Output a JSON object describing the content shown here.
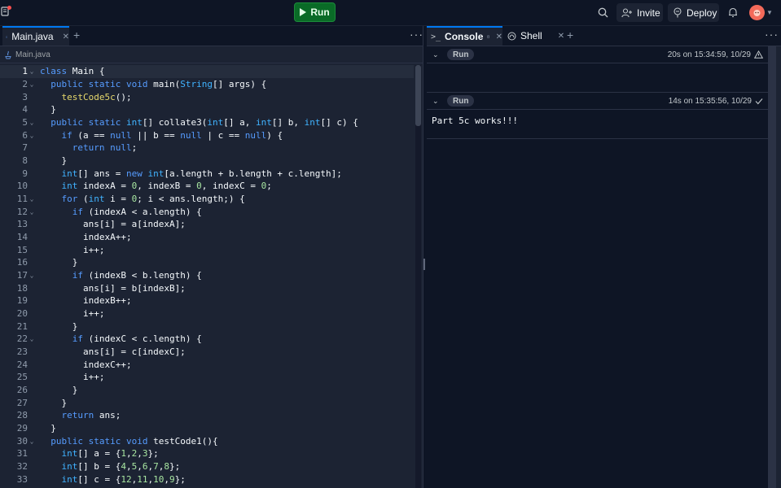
{
  "header": {
    "run_label": "Run",
    "invite_label": "Invite",
    "deploy_label": "Deploy"
  },
  "editor": {
    "tab_label": "Main.java",
    "breadcrumb": "Main.java",
    "lines": [
      {
        "n": "1",
        "fold": true,
        "html": "<span class=\"kw\">class</span> Main {"
      },
      {
        "n": "2",
        "fold": true,
        "html": "  <span class=\"kw\">public static void</span> main(<span class=\"ty\">String</span>[] args) {"
      },
      {
        "n": "3",
        "fold": false,
        "html": "    <span class=\"fn\">testCode5c</span>();"
      },
      {
        "n": "4",
        "fold": false,
        "html": "  }"
      },
      {
        "n": "5",
        "fold": true,
        "html": "  <span class=\"kw\">public static</span> <span class=\"ty\">int</span>[] collate3(<span class=\"ty\">int</span>[] a, <span class=\"ty\">int</span>[] b, <span class=\"ty\">int</span>[] c) {"
      },
      {
        "n": "6",
        "fold": true,
        "html": "    <span class=\"kw\">if</span> (a == <span class=\"kw\">null</span> || b == <span class=\"kw\">null</span> | c == <span class=\"kw\">null</span>) {"
      },
      {
        "n": "7",
        "fold": false,
        "html": "      <span class=\"kw\">return null</span>;"
      },
      {
        "n": "8",
        "fold": false,
        "html": "    }"
      },
      {
        "n": "9",
        "fold": false,
        "html": "    <span class=\"ty\">int</span>[] ans = <span class=\"kw\">new</span> <span class=\"ty\">int</span>[a.length + b.length + c.length];"
      },
      {
        "n": "10",
        "fold": false,
        "html": "    <span class=\"ty\">int</span> indexA = <span class=\"num\">0</span>, indexB = <span class=\"num\">0</span>, indexC = <span class=\"num\">0</span>;"
      },
      {
        "n": "11",
        "fold": true,
        "html": "    <span class=\"kw\">for</span> (<span class=\"ty\">int</span> i = <span class=\"num\">0</span>; i < ans.length;) {"
      },
      {
        "n": "12",
        "fold": true,
        "html": "      <span class=\"kw\">if</span> (indexA < a.length) {"
      },
      {
        "n": "13",
        "fold": false,
        "html": "        ans[i] = a[indexA];"
      },
      {
        "n": "14",
        "fold": false,
        "html": "        indexA++;"
      },
      {
        "n": "15",
        "fold": false,
        "html": "        i++;"
      },
      {
        "n": "16",
        "fold": false,
        "html": "      }"
      },
      {
        "n": "17",
        "fold": true,
        "html": "      <span class=\"kw\">if</span> (indexB < b.length) {"
      },
      {
        "n": "18",
        "fold": false,
        "html": "        ans[i] = b[indexB];"
      },
      {
        "n": "19",
        "fold": false,
        "html": "        indexB++;"
      },
      {
        "n": "20",
        "fold": false,
        "html": "        i++;"
      },
      {
        "n": "21",
        "fold": false,
        "html": "      }"
      },
      {
        "n": "22",
        "fold": true,
        "html": "      <span class=\"kw\">if</span> (indexC < c.length) {"
      },
      {
        "n": "23",
        "fold": false,
        "html": "        ans[i] = c[indexC];"
      },
      {
        "n": "24",
        "fold": false,
        "html": "        indexC++;"
      },
      {
        "n": "25",
        "fold": false,
        "html": "        i++;"
      },
      {
        "n": "26",
        "fold": false,
        "html": "      }"
      },
      {
        "n": "27",
        "fold": false,
        "html": "    }"
      },
      {
        "n": "28",
        "fold": false,
        "html": "    <span class=\"kw\">return</span> ans;"
      },
      {
        "n": "29",
        "fold": false,
        "html": "  }"
      },
      {
        "n": "30",
        "fold": true,
        "html": "  <span class=\"kw\">public static void</span> testCode1(){"
      },
      {
        "n": "31",
        "fold": false,
        "html": "    <span class=\"ty\">int</span>[] a = {<span class=\"num\">1</span>,<span class=\"num\">2</span>,<span class=\"num\">3</span>};"
      },
      {
        "n": "32",
        "fold": false,
        "html": "    <span class=\"ty\">int</span>[] b = {<span class=\"num\">4</span>,<span class=\"num\">5</span>,<span class=\"num\">6</span>,<span class=\"num\">7</span>,<span class=\"num\">8</span>};"
      },
      {
        "n": "33",
        "fold": false,
        "html": "    <span class=\"ty\">int</span>[] c = {<span class=\"num\">12</span>,<span class=\"num\">11</span>,<span class=\"num\">10</span>,<span class=\"num\">9</span>};"
      }
    ]
  },
  "console": {
    "tab_console": "Console",
    "tab_shell": "Shell",
    "runs": [
      {
        "label": "Run",
        "meta": "20s on 15:34:59, 10/29",
        "status": "warning",
        "output": ""
      },
      {
        "label": "Run",
        "meta": "14s on 15:35:56, 10/29",
        "status": "success",
        "output": "Part 5c works!!!"
      }
    ]
  }
}
